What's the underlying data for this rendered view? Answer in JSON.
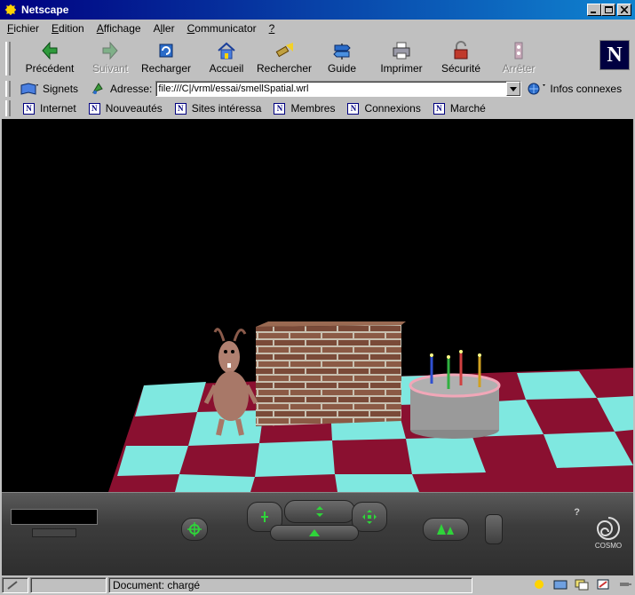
{
  "window": {
    "title": "Netscape"
  },
  "menu": {
    "items": [
      {
        "label": "Fichier",
        "mnemonic": "F"
      },
      {
        "label": "Edition",
        "mnemonic": "E"
      },
      {
        "label": "Affichage",
        "mnemonic": "A"
      },
      {
        "label": "Aller",
        "mnemonic": "l"
      },
      {
        "label": "Communicator",
        "mnemonic": "C"
      },
      {
        "label": "?",
        "mnemonic": "?"
      }
    ]
  },
  "toolbar": {
    "back_label": "Précédent",
    "forward_label": "Suivant",
    "reload_label": "Recharger",
    "home_label": "Accueil",
    "search_label": "Rechercher",
    "guide_label": "Guide",
    "print_label": "Imprimer",
    "security_label": "Sécurité",
    "stop_label": "Arrêter"
  },
  "location": {
    "bookmarks_label": "Signets",
    "address_label": "Adresse:",
    "url": "file:///C|/vrml/essai/smellSpatial.wrl",
    "related_label": "Infos connexes"
  },
  "personal_toolbar": {
    "items": [
      "Internet",
      "Nouveautés",
      "Sites intéressa",
      "Membres",
      "Connexions",
      "Marché"
    ]
  },
  "cosmo": {
    "brand": "COSMO",
    "help": "?"
  },
  "status": {
    "text": "Document: chargé"
  },
  "colors": {
    "titlebar_start": "#000080",
    "titlebar_end": "#1084d0",
    "chrome": "#c0c0c0",
    "floor_cyan": "#7fe8e0",
    "floor_maroon": "#8a1030",
    "brick": "#8b5a45",
    "cake": "#9a9a9a",
    "icing": "#f1a7b8"
  }
}
